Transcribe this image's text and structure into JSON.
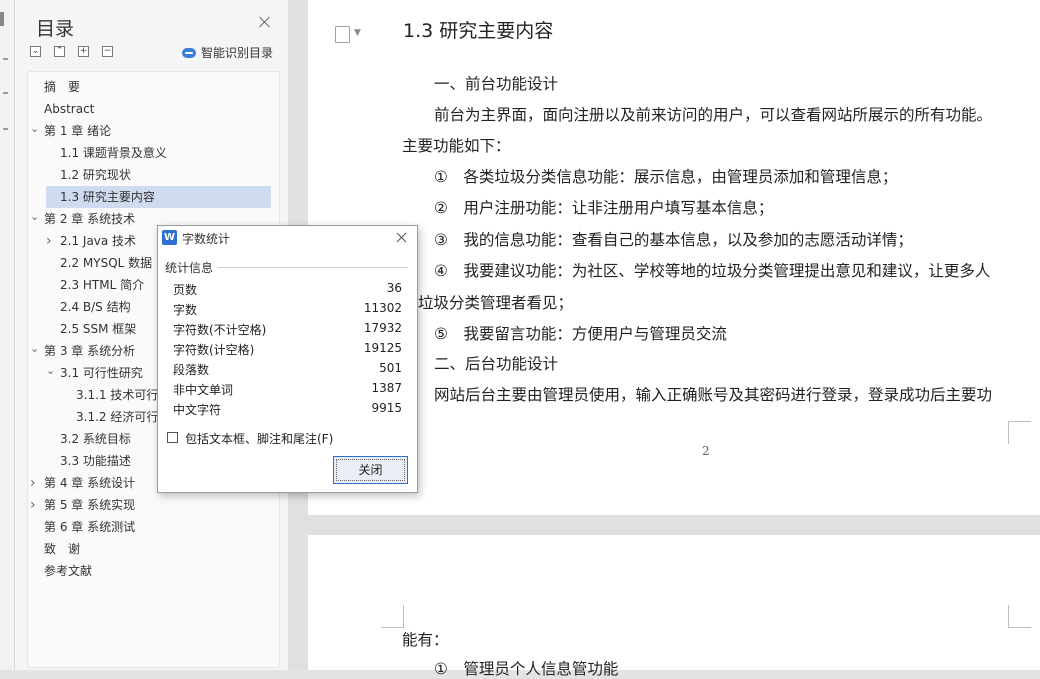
{
  "nav": {
    "title": "目录",
    "smart_label": "智能识别目录",
    "toc": [
      {
        "label": "摘　要",
        "level": 0,
        "chevron": "",
        "selected": false
      },
      {
        "label": "Abstract",
        "level": 0,
        "chevron": "",
        "selected": false
      },
      {
        "label": "第 1 章  绪论",
        "level": 0,
        "chevron": "down",
        "selected": false
      },
      {
        "label": "1.1 课题背景及意义",
        "level": 1,
        "chevron": "",
        "selected": false
      },
      {
        "label": "1.2 研究现状",
        "level": 1,
        "chevron": "",
        "selected": false
      },
      {
        "label": "1.3 研究主要内容",
        "level": 1,
        "chevron": "",
        "selected": true
      },
      {
        "label": "第 2 章  系统技术",
        "level": 0,
        "chevron": "down",
        "selected": false
      },
      {
        "label": "2.1 Java 技术",
        "level": 1,
        "chevron": "right",
        "selected": false
      },
      {
        "label": "2.2 MYSQL 数据",
        "level": 1,
        "chevron": "",
        "selected": false
      },
      {
        "label": "2.3 HTML 简介",
        "level": 1,
        "chevron": "",
        "selected": false
      },
      {
        "label": "2.4 B/S 结构",
        "level": 1,
        "chevron": "",
        "selected": false
      },
      {
        "label": "2.5 SSM 框架",
        "level": 1,
        "chevron": "",
        "selected": false
      },
      {
        "label": "第 3 章  系统分析",
        "level": 0,
        "chevron": "down",
        "selected": false
      },
      {
        "label": "3.1 可行性研究",
        "level": 1,
        "chevron": "down",
        "selected": false
      },
      {
        "label": "3.1.1 技术可行",
        "level": 2,
        "chevron": "",
        "selected": false
      },
      {
        "label": "3.1.2 经济可行",
        "level": 2,
        "chevron": "",
        "selected": false
      },
      {
        "label": "3.2 系统目标",
        "level": 1,
        "chevron": "",
        "selected": false
      },
      {
        "label": "3.3 功能描述",
        "level": 1,
        "chevron": "",
        "selected": false
      },
      {
        "label": "第 4 章  系统设计",
        "level": 0,
        "chevron": "right",
        "selected": false
      },
      {
        "label": "第 5 章  系统实现",
        "level": 0,
        "chevron": "right",
        "selected": false
      },
      {
        "label": "第 6 章  系统测试",
        "level": 0,
        "chevron": "",
        "selected": false
      },
      {
        "label": "致　谢",
        "level": 0,
        "chevron": "",
        "selected": false
      },
      {
        "label": "参考文献",
        "level": 0,
        "chevron": "",
        "selected": false
      }
    ]
  },
  "document": {
    "heading": "1.3 研究主要内容",
    "lines": [
      "一、前台功能设计",
      "前台为主界面，面向注册以及前来访问的用户，可以查看网站所展示的所有功能。",
      "主要功能如下：",
      "①　各类垃圾分类信息功能：展示信息，由管理员添加和管理信息；",
      "②　用户注册功能：让非注册用户填写基本信息；",
      "③　我的信息功能：查看自己的基本信息，以及参加的志愿活动详情；",
      "④　我要建议功能：为社区、学校等地的垃圾分类管理提出意见和建议，让更多人",
      "垃圾分类管理者看见；",
      "⑤　我要留言功能：方便用户与管理员交流",
      "二、后台功能设计",
      "网站后台主要由管理员使用，输入正确账号及其密码进行登录，登录成功后主要功"
    ],
    "page_number": "2",
    "page2_lines": [
      "能有：",
      "①　管理员个人信息管功能"
    ]
  },
  "dialog": {
    "title": "字数统计",
    "group_label": "统计信息",
    "stats": [
      {
        "label": "页数",
        "value": "36"
      },
      {
        "label": "字数",
        "value": "11302"
      },
      {
        "label": "字符数(不计空格)",
        "value": "17932"
      },
      {
        "label": "字符数(计空格)",
        "value": "19125"
      },
      {
        "label": "段落数",
        "value": "501"
      },
      {
        "label": "非中文单词",
        "value": "1387"
      },
      {
        "label": "中文字符",
        "value": "9915"
      }
    ],
    "checkbox_label": "包括文本框、脚注和尾注(F)",
    "checkbox_checked": false,
    "close_button": "关闭"
  },
  "colors": {
    "selection": "#cfdbee",
    "accent": "#2f6fd1"
  }
}
